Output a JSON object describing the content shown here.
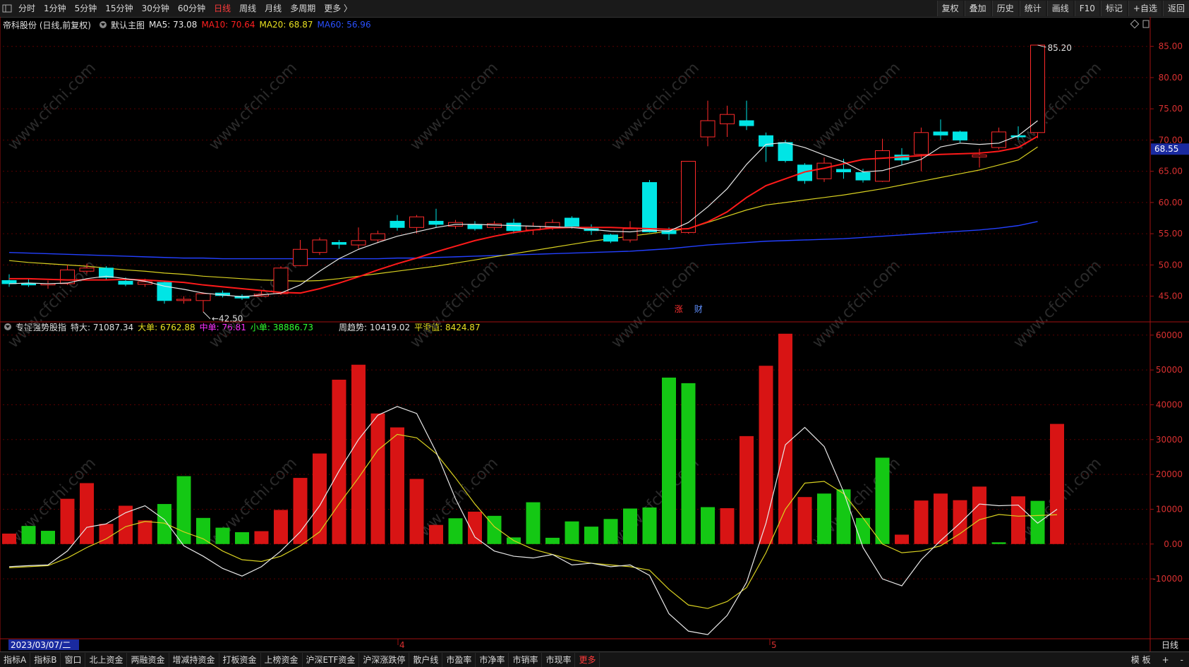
{
  "toolbar": {
    "periods": [
      "分时",
      "1分钟",
      "5分钟",
      "15分钟",
      "30分钟",
      "60分钟",
      "日线",
      "周线",
      "月线",
      "多周期",
      "更多 〉"
    ],
    "active_period": "日线",
    "right_buttons": [
      "复权",
      "叠加",
      "历史",
      "统计",
      "画线",
      "F10",
      "标记",
      "+自选",
      "返回"
    ]
  },
  "main_legend": {
    "stock": "帝科股份 (日线,前复权)",
    "template": "默认主图",
    "ma5": "MA5: 73.08",
    "ma10": "MA10: 70.64",
    "ma20": "MA20: 68.87",
    "ma60": "MA60: 56.96",
    "colors": {
      "ma5": "#e8e8e8",
      "ma10": "#ff2020",
      "ma20": "#e8e020",
      "ma60": "#2040ff"
    }
  },
  "sub_legend": {
    "name": "专捉强势股指",
    "tebig": "特大: 71087.34",
    "big": "大单: 6762.88",
    "mid": "中单: 76.81",
    "small": "小单: 38886.73",
    "week_trend": "周趋势: 10419.02",
    "smooth": "平滑值: 8424.87"
  },
  "markers": {
    "zhang": "涨",
    "cai": "财"
  },
  "date_label": "2023/03/07/二",
  "month_labels": [
    "4",
    "5"
  ],
  "period_label": "日线",
  "bottom_tabs": [
    "指标A",
    "指标B",
    "窗口",
    "北上资金",
    "两融资金",
    "增减持资金",
    "打板资金",
    "上榜资金",
    "沪深ETF资金",
    "沪深涨跌停",
    "散户线",
    "市盈率",
    "市净率",
    "市销率",
    "市现率",
    "更多"
  ],
  "bottom_right": [
    "模 板",
    "+",
    "-"
  ],
  "watermark": "www.cfchi.com",
  "chart_data": [
    {
      "type": "candlestick",
      "ylim": [
        41,
        87
      ],
      "yticks": [
        45,
        50,
        55,
        60,
        65,
        70,
        75,
        80,
        85
      ],
      "current_price": "68.55",
      "high_label": "85.20",
      "low_label": "42.50",
      "candles": [
        {
          "o": 47.5,
          "c": 47.0,
          "h": 48.5,
          "l": 46.5
        },
        {
          "o": 47.0,
          "c": 46.8,
          "h": 47.8,
          "l": 46.5
        },
        {
          "o": 46.8,
          "c": 47.0,
          "h": 47.5,
          "l": 46.2
        },
        {
          "o": 47.0,
          "c": 49.2,
          "h": 50.0,
          "l": 46.8
        },
        {
          "o": 49.0,
          "c": 49.5,
          "h": 50.2,
          "l": 48.6
        },
        {
          "o": 49.5,
          "c": 48.0,
          "h": 49.8,
          "l": 47.6
        },
        {
          "o": 47.4,
          "c": 46.9,
          "h": 48.0,
          "l": 46.6
        },
        {
          "o": 46.9,
          "c": 47.3,
          "h": 47.8,
          "l": 46.5
        },
        {
          "o": 47.2,
          "c": 44.3,
          "h": 47.5,
          "l": 43.8
        },
        {
          "o": 44.3,
          "c": 44.5,
          "h": 45.0,
          "l": 43.8
        },
        {
          "o": 44.3,
          "c": 45.4,
          "h": 45.6,
          "l": 42.5
        },
        {
          "o": 45.5,
          "c": 45.1,
          "h": 45.9,
          "l": 44.8
        },
        {
          "o": 45.0,
          "c": 44.7,
          "h": 45.3,
          "l": 44.4
        },
        {
          "o": 45.0,
          "c": 45.3,
          "h": 45.8,
          "l": 44.9
        },
        {
          "o": 45.4,
          "c": 49.5,
          "h": 49.8,
          "l": 45.2
        },
        {
          "o": 49.9,
          "c": 52.5,
          "h": 54.0,
          "l": 49.8
        },
        {
          "o": 52.0,
          "c": 54.0,
          "h": 54.4,
          "l": 51.6
        },
        {
          "o": 53.6,
          "c": 53.3,
          "h": 54.0,
          "l": 52.6
        },
        {
          "o": 53.2,
          "c": 53.9,
          "h": 56.0,
          "l": 52.6
        },
        {
          "o": 54.0,
          "c": 55.0,
          "h": 55.5,
          "l": 53.5
        },
        {
          "o": 57.0,
          "c": 56.0,
          "h": 58.0,
          "l": 55.5
        },
        {
          "o": 56.0,
          "c": 57.7,
          "h": 58.0,
          "l": 55.0
        },
        {
          "o": 57.0,
          "c": 56.5,
          "h": 59.0,
          "l": 56.0
        },
        {
          "o": 56.2,
          "c": 56.8,
          "h": 57.2,
          "l": 55.8
        },
        {
          "o": 56.5,
          "c": 55.8,
          "h": 57.0,
          "l": 55.5
        },
        {
          "o": 56.0,
          "c": 56.6,
          "h": 57.0,
          "l": 55.6
        },
        {
          "o": 56.7,
          "c": 55.5,
          "h": 57.4,
          "l": 55.0
        },
        {
          "o": 55.6,
          "c": 56.2,
          "h": 56.8,
          "l": 54.8
        },
        {
          "o": 56.0,
          "c": 56.8,
          "h": 57.3,
          "l": 55.6
        },
        {
          "o": 57.5,
          "c": 56.2,
          "h": 57.8,
          "l": 55.8
        },
        {
          "o": 55.8,
          "c": 55.5,
          "h": 56.5,
          "l": 54.8
        },
        {
          "o": 54.8,
          "c": 53.8,
          "h": 55.0,
          "l": 53.5
        },
        {
          "o": 54.0,
          "c": 55.8,
          "h": 57.0,
          "l": 53.6
        },
        {
          "o": 63.2,
          "c": 55.3,
          "h": 63.6,
          "l": 55.2
        },
        {
          "o": 55.5,
          "c": 55.0,
          "h": 56.0,
          "l": 54.0
        },
        {
          "o": 55.2,
          "c": 66.6,
          "h": 66.6,
          "l": 55.0
        },
        {
          "o": 70.5,
          "c": 73.1,
          "h": 76.3,
          "l": 69.0
        },
        {
          "o": 72.6,
          "c": 74.1,
          "h": 75.5,
          "l": 70.5
        },
        {
          "o": 73.1,
          "c": 72.3,
          "h": 76.3,
          "l": 71.6
        },
        {
          "o": 70.7,
          "c": 69.0,
          "h": 71.2,
          "l": 66.5
        },
        {
          "o": 69.6,
          "c": 66.7,
          "h": 70.0,
          "l": 66.4
        },
        {
          "o": 66.0,
          "c": 63.5,
          "h": 66.3,
          "l": 63.0
        },
        {
          "o": 63.8,
          "c": 66.3,
          "h": 67.2,
          "l": 63.3
        },
        {
          "o": 65.3,
          "c": 64.9,
          "h": 67.0,
          "l": 63.8
        },
        {
          "o": 64.8,
          "c": 63.6,
          "h": 65.4,
          "l": 63.2
        },
        {
          "o": 63.4,
          "c": 68.3,
          "h": 70.2,
          "l": 63.3
        },
        {
          "o": 67.6,
          "c": 66.8,
          "h": 68.7,
          "l": 66.0
        },
        {
          "o": 67.7,
          "c": 71.2,
          "h": 72.0,
          "l": 65.0
        },
        {
          "o": 71.3,
          "c": 70.8,
          "h": 73.3,
          "l": 70.0
        },
        {
          "o": 71.3,
          "c": 70.0,
          "h": 71.5,
          "l": 69.6
        },
        {
          "o": 67.3,
          "c": 67.6,
          "h": 68.6,
          "l": 65.6
        },
        {
          "o": 68.8,
          "c": 71.3,
          "h": 72.0,
          "l": 68.5
        },
        {
          "o": 70.7,
          "c": 70.5,
          "h": 72.2,
          "l": 70.0
        },
        {
          "o": 71.2,
          "c": 85.2,
          "h": 85.2,
          "l": 70.3
        }
      ],
      "ma5": [
        47.0,
        47.1,
        47.0,
        47.1,
        47.8,
        48.2,
        47.8,
        47.4,
        46.6,
        46.1,
        45.5,
        45.2,
        44.9,
        45.2,
        45.5,
        46.8,
        49.0,
        51.0,
        52.5,
        53.6,
        54.6,
        55.3,
        56.0,
        56.5,
        56.5,
        56.4,
        56.3,
        56.2,
        56.1,
        56.0,
        55.7,
        55.4,
        55.3,
        55.6,
        55.4,
        56.8,
        59.3,
        62.2,
        66.1,
        69.3,
        69.6,
        68.8,
        67.6,
        66.5,
        64.9,
        65.1,
        66.0,
        66.9,
        68.9,
        69.5,
        69.3,
        69.5,
        70.7,
        73.1
      ],
      "ma10": [
        47.8,
        47.8,
        47.7,
        47.6,
        47.6,
        47.6,
        47.7,
        47.6,
        47.4,
        47.2,
        46.8,
        46.5,
        46.2,
        45.9,
        45.6,
        45.5,
        46.2,
        47.1,
        48.1,
        49.2,
        50.2,
        51.1,
        52.1,
        53.0,
        53.9,
        54.6,
        55.2,
        55.6,
        55.9,
        56.0,
        56.0,
        56.0,
        55.9,
        55.8,
        55.7,
        55.8,
        56.9,
        58.5,
        60.8,
        62.7,
        63.8,
        64.9,
        65.5,
        66.2,
        66.9,
        67.1,
        67.3,
        67.5,
        67.7,
        67.8,
        67.9,
        68.2,
        68.8,
        70.6
      ],
      "ma20": [
        50.7,
        50.4,
        50.2,
        50.0,
        49.8,
        49.5,
        49.2,
        49.0,
        48.7,
        48.5,
        48.2,
        48.0,
        47.8,
        47.6,
        47.5,
        47.4,
        47.5,
        47.8,
        48.2,
        48.6,
        49.0,
        49.4,
        49.8,
        50.3,
        50.8,
        51.3,
        51.8,
        52.3,
        52.8,
        53.3,
        53.8,
        54.2,
        54.6,
        55.0,
        55.4,
        55.8,
        56.8,
        57.8,
        58.8,
        59.6,
        60.0,
        60.4,
        60.8,
        61.2,
        61.7,
        62.2,
        62.8,
        63.4,
        64.0,
        64.6,
        65.2,
        66.0,
        66.8,
        68.9
      ],
      "ma60": [
        52.0,
        51.9,
        51.8,
        51.7,
        51.6,
        51.5,
        51.4,
        51.3,
        51.2,
        51.1,
        51.1,
        51.0,
        51.0,
        51.0,
        51.0,
        51.0,
        51.0,
        51.0,
        51.0,
        51.0,
        51.1,
        51.1,
        51.2,
        51.3,
        51.4,
        51.5,
        51.6,
        51.7,
        51.8,
        51.9,
        52.0,
        52.1,
        52.2,
        52.4,
        52.6,
        52.9,
        53.2,
        53.4,
        53.6,
        53.8,
        53.9,
        54.0,
        54.1,
        54.2,
        54.4,
        54.6,
        54.8,
        55.0,
        55.2,
        55.4,
        55.6,
        55.9,
        56.3,
        56.96
      ]
    },
    {
      "type": "bar",
      "ylim": [
        -27000,
        63000
      ],
      "yticks": [
        -10000,
        0,
        10000,
        20000,
        30000,
        40000,
        50000,
        60000
      ],
      "values": [
        3000,
        5200,
        3800,
        13000,
        17500,
        5800,
        11000,
        6800,
        11500,
        19500,
        7500,
        4700,
        3400,
        3700,
        9800,
        19000,
        26000,
        47200,
        51500,
        37500,
        33500,
        18700,
        5500,
        7400,
        9300,
        8100,
        1900,
        12000,
        1800,
        6500,
        5000,
        7200,
        10200,
        10500,
        47800,
        46200,
        10600,
        10300,
        31000,
        51200,
        60400,
        13500,
        14500,
        15700,
        7500,
        24800,
        2700,
        12500,
        14500,
        12600,
        16500,
        500,
        13700,
        12400,
        34500
      ],
      "colors": [
        "r",
        "g",
        "g",
        "r",
        "r",
        "r",
        "r",
        "r",
        "g",
        "g",
        "g",
        "g",
        "g",
        "r",
        "r",
        "r",
        "r",
        "r",
        "r",
        "r",
        "r",
        "r",
        "r",
        "g",
        "r",
        "g",
        "g",
        "g",
        "g",
        "g",
        "g",
        "g",
        "g",
        "g",
        "g",
        "g",
        "g",
        "r",
        "r",
        "r",
        "r",
        "r",
        "g",
        "g",
        "g",
        "g",
        "r",
        "r",
        "r",
        "r",
        "r",
        "g",
        "r",
        "g",
        "r"
      ],
      "week_trend": [
        -6500,
        -6200,
        -6000,
        -2000,
        4800,
        5800,
        9000,
        11000,
        7000,
        -500,
        -3500,
        -7000,
        -9200,
        -6500,
        -2000,
        3500,
        11000,
        21000,
        30000,
        37000,
        39500,
        37500,
        26500,
        13000,
        2000,
        -2000,
        -3500,
        -4000,
        -3000,
        -6000,
        -5500,
        -6500,
        -6000,
        -9000,
        -20000,
        -25000,
        -26000,
        -20500,
        -11000,
        6000,
        28500,
        33500,
        28000,
        15000,
        -1000,
        -10000,
        -12000,
        -4500,
        1000,
        6000,
        11500,
        11000,
        11200,
        6000,
        10000
      ],
      "smooth": [
        -6800,
        -6500,
        -6200,
        -4000,
        -1000,
        1500,
        5000,
        6500,
        6000,
        3500,
        1500,
        -2000,
        -4500,
        -5000,
        -3500,
        -500,
        3500,
        11500,
        19000,
        27000,
        31500,
        30500,
        26000,
        19000,
        11500,
        5000,
        1000,
        -1500,
        -3000,
        -4500,
        -5500,
        -6000,
        -6500,
        -7500,
        -13000,
        -17500,
        -18500,
        -16500,
        -12500,
        -2500,
        10000,
        17500,
        18000,
        14500,
        7500,
        0,
        -2500,
        -2000,
        -500,
        3000,
        7000,
        8500,
        8000,
        8200,
        8424
      ]
    }
  ]
}
